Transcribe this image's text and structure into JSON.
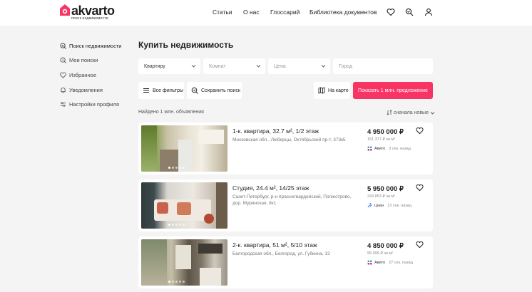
{
  "header": {
    "logo_text": "akvarto",
    "logo_sub": "поиск недвижимости",
    "nav": [
      "Статьи",
      "О нас",
      "Глоссарий",
      "Библиотека документов"
    ],
    "accent": "#f73463"
  },
  "sidebar": {
    "items": [
      {
        "label": "Поиск недвижимости",
        "icon": "search-home-icon"
      },
      {
        "label": "Мои поиски",
        "icon": "search-history-icon"
      },
      {
        "label": "Избранное",
        "icon": "heart-icon"
      },
      {
        "label": "Уведомления",
        "icon": "bell-icon"
      },
      {
        "label": "Настройки профиля",
        "icon": "sliders-icon"
      }
    ]
  },
  "page": {
    "title": "Купить недвижимость"
  },
  "filters": {
    "type_value": "Квартиру",
    "rooms_placeholder": "Комнат",
    "price_placeholder": "Цена",
    "city_placeholder": "Город"
  },
  "actions": {
    "all_filters": "Все фильтры",
    "save_search": "Сохранить поиск",
    "on_map": "На карте",
    "show": "Показать 1 млн. предложение"
  },
  "results": {
    "found": "Найдено 1 млн. объявления",
    "sort": "сначала новые"
  },
  "listings": [
    {
      "title": "1-к. квартира, 32.7 м², 1/2 этаж",
      "address": "Московская обл., Люберцы, Октябрьский пр-т, 373к5",
      "price": "4 950 000 ₽",
      "ppm": "151 377 ₽ за м²",
      "source": "Авито",
      "ago": "3 сек. назад"
    },
    {
      "title": "Студия, 24.4 м², 14/25 этаж",
      "address": "Санкт-Петербург, р-н Красногвардейский, Полюстрово, дор. Муринская, 8к1",
      "price": "5 950 000 ₽",
      "ppm": "243 853 ₽ за м²",
      "source": "Циан",
      "ago": "13 сек. назад"
    },
    {
      "title": "2-к. квартира, 51 м², 5/10 этаж",
      "address": "Белгородская обл., Белгород, ул. Губкина, 13",
      "price": "4 850 000 ₽",
      "ppm": "95 099 ₽ за м²",
      "source": "Авито",
      "ago": "27 сек. назад"
    }
  ]
}
